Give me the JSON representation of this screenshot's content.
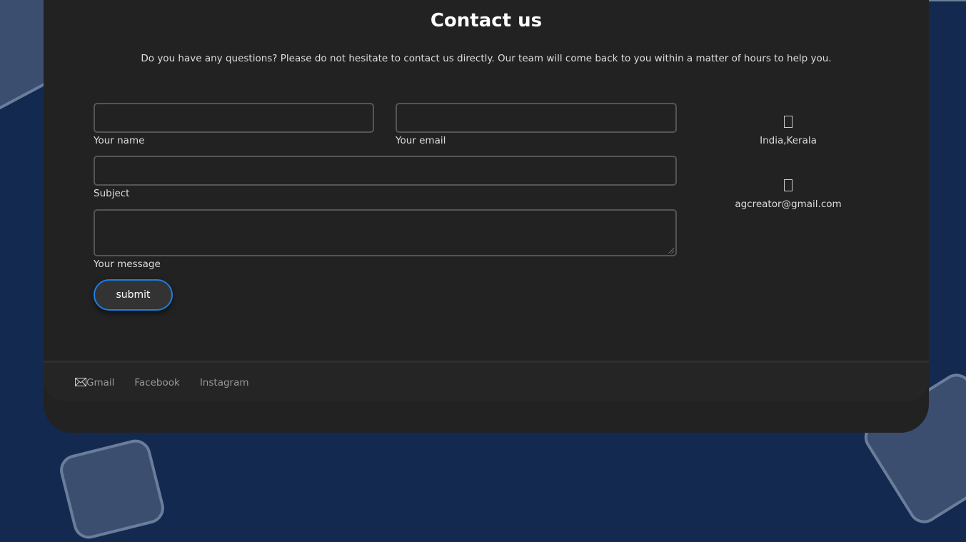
{
  "title": "Contact us",
  "intro": "Do you have any questions? Please do not hesitate to contact us directly. Our team will come back to you within a matter of hours to help you.",
  "form": {
    "name_label": "Your name",
    "email_label": "Your email",
    "subject_label": "Subject",
    "message_label": "Your message",
    "submit_label": "submit"
  },
  "info": [
    {
      "icon": "location-icon",
      "text": "India,Kerala"
    },
    {
      "icon": "email-icon",
      "text": "agcreator@gmail.com"
    }
  ],
  "footer": {
    "links": [
      "Gmail",
      "Facebook",
      "Instagram"
    ]
  },
  "colors": {
    "background": "#13294f",
    "card": "#222222",
    "accent": "#1e7de0"
  }
}
